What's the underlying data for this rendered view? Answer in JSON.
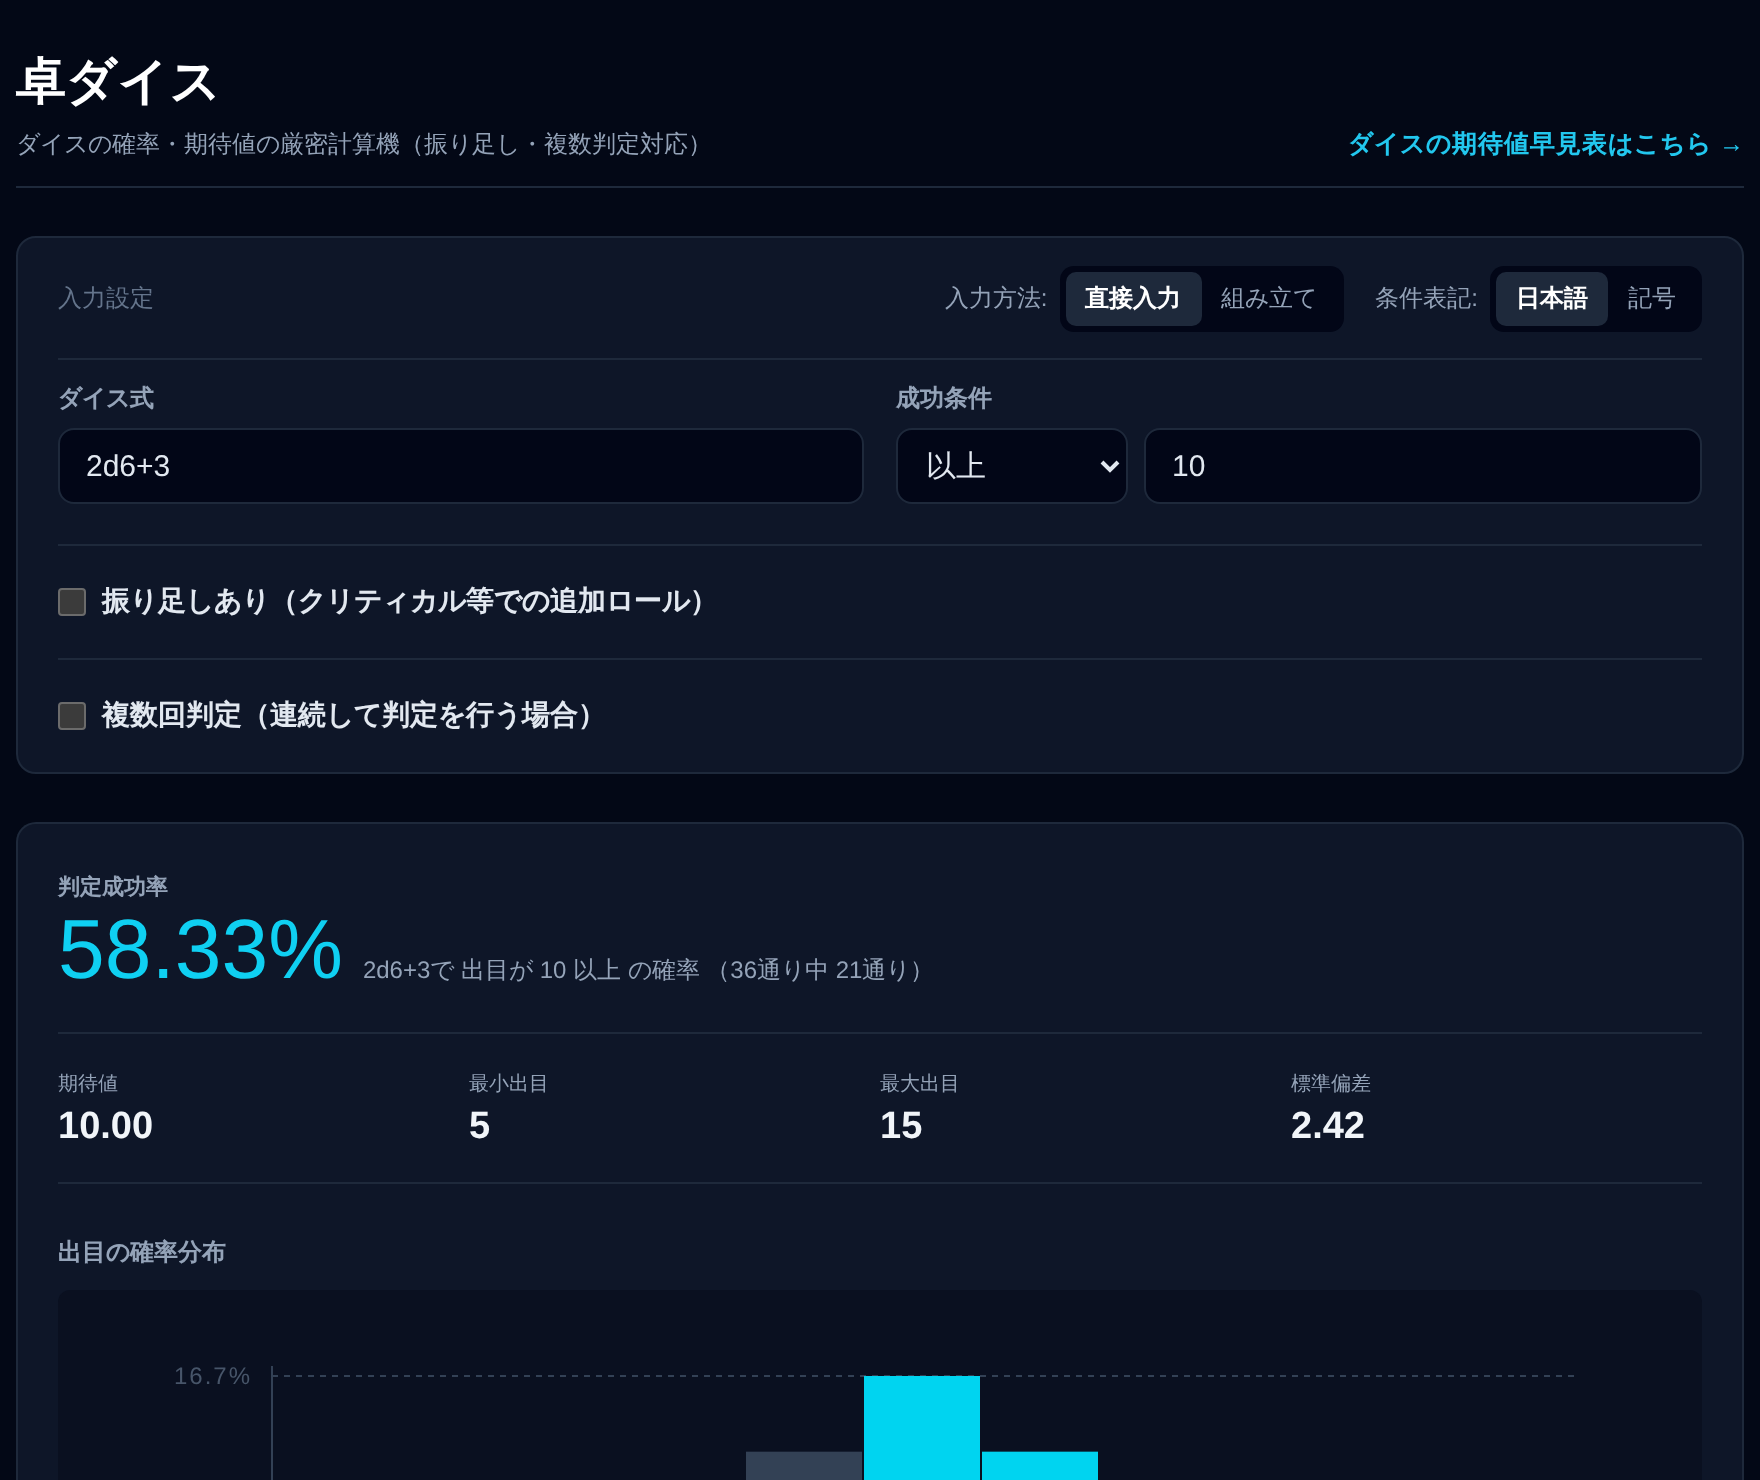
{
  "header": {
    "title": "卓ダイス",
    "subtitle": "ダイスの確率・期待値の厳密計算機（振り足し・複数判定対応）",
    "link": "ダイスの期待値早見表はこちら →"
  },
  "input_settings": {
    "heading": "入力設定",
    "toggles": [
      {
        "label": "入力方法:",
        "options": [
          {
            "label": "直接入力",
            "selected": true
          },
          {
            "label": "組み立て",
            "selected": false
          }
        ]
      },
      {
        "label": "条件表記:",
        "options": [
          {
            "label": "日本語",
            "selected": true
          },
          {
            "label": "記号",
            "selected": false
          }
        ]
      }
    ],
    "dice_formula": {
      "label": "ダイス式",
      "value": "2d6+3"
    },
    "success_condition": {
      "label": "成功条件",
      "operator": {
        "value": "以上",
        "kind": "ge"
      },
      "target": "10"
    },
    "options": [
      {
        "label": "振り足しあり（クリティカル等での追加ロール）",
        "checked": false
      },
      {
        "label": "複数回判定（連続して判定を行う場合）",
        "checked": false
      }
    ]
  },
  "result": {
    "heading": "判定成功率",
    "rate": "58.33%",
    "summary": "2d6+3で 出目が 10 以上 の確率 （36通り中 21通り）",
    "stats": [
      {
        "label": "期待値",
        "value": "10.00"
      },
      {
        "label": "最小出目",
        "value": "5"
      },
      {
        "label": "最大出目",
        "value": "15"
      },
      {
        "label": "標準偏差",
        "value": "2.42"
      }
    ],
    "distribution": {
      "heading": "出目の確率分布",
      "top_label": "16.7%"
    }
  }
}
